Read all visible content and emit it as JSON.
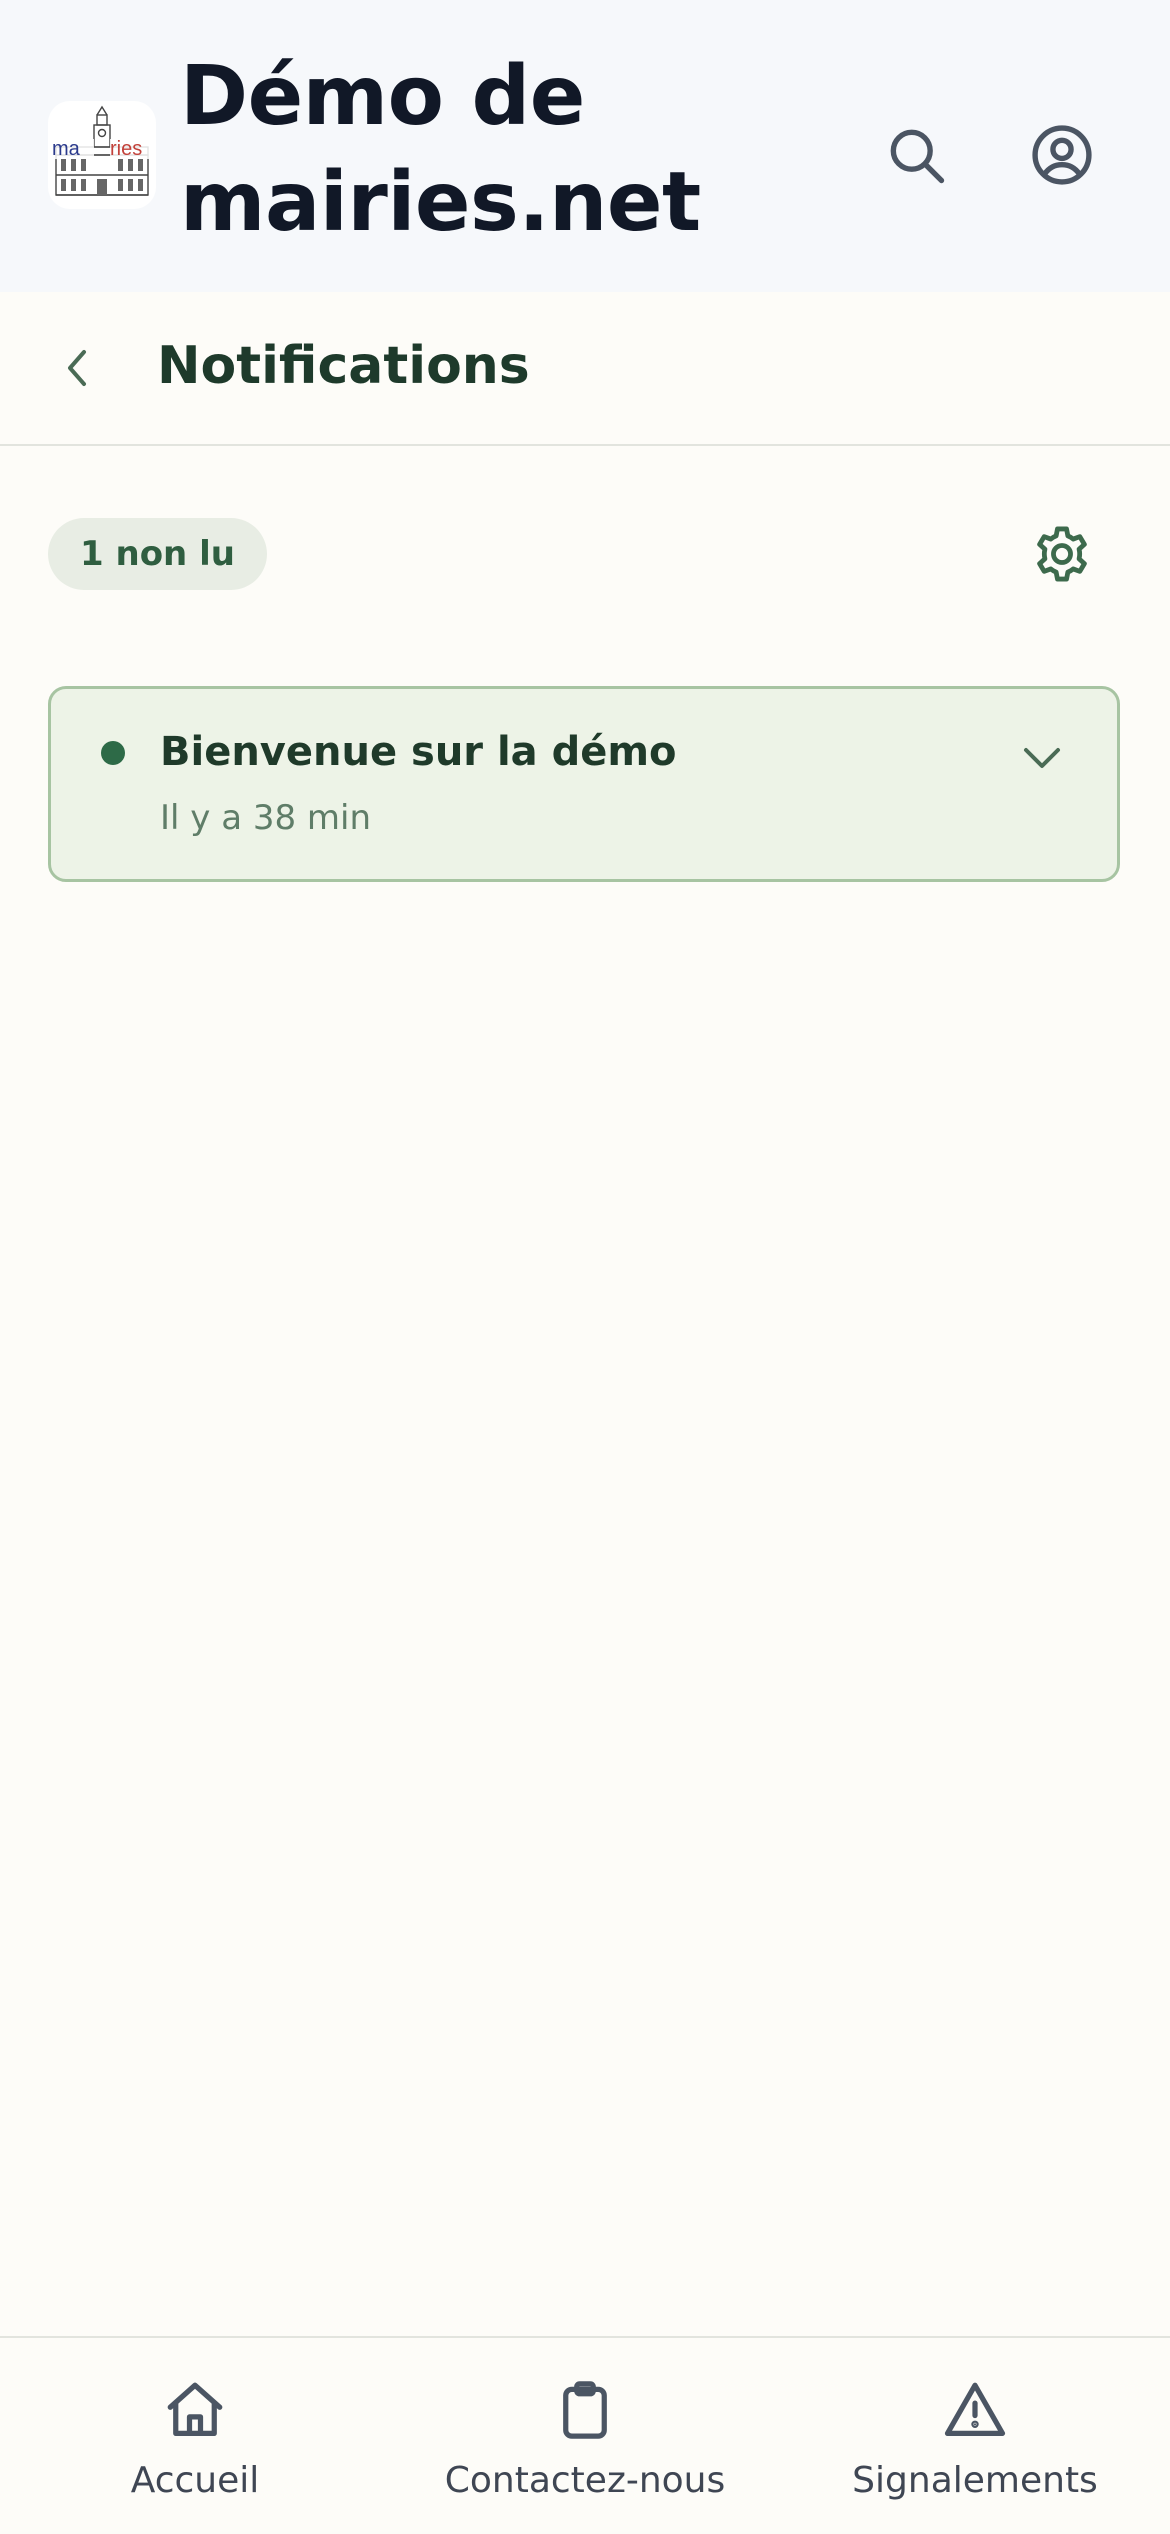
{
  "header": {
    "app_title": "Démo de mairies.net",
    "logo": {
      "text_left": "ma",
      "text_right": "ries",
      "color_left": "#2b3a8c",
      "color_right": "#c2413a"
    },
    "icons": [
      "search-icon",
      "user-circle-icon"
    ]
  },
  "page": {
    "title": "Notifications",
    "back_icon": "chevron-left-icon"
  },
  "toolbar": {
    "unread_badge": "1 non lu",
    "settings_icon": "gear-icon"
  },
  "notifications": [
    {
      "title": "Bienvenue sur la démo",
      "time": "Il y a 38 min",
      "unread": true,
      "expand_icon": "chevron-down-icon"
    }
  ],
  "bottom_nav": {
    "items": [
      {
        "label": "Accueil",
        "icon": "home-icon"
      },
      {
        "label": "Contactez-nous",
        "icon": "clipboard-icon"
      },
      {
        "label": "Signalements",
        "icon": "warning-icon"
      }
    ]
  },
  "colors": {
    "header_bg": "#f6f8fb",
    "page_bg": "#fdfcf8",
    "accent_green": "#2d6a47",
    "title_dark": "#111827",
    "card_bg": "#edf3e7",
    "card_border": "#a7c4a2"
  }
}
